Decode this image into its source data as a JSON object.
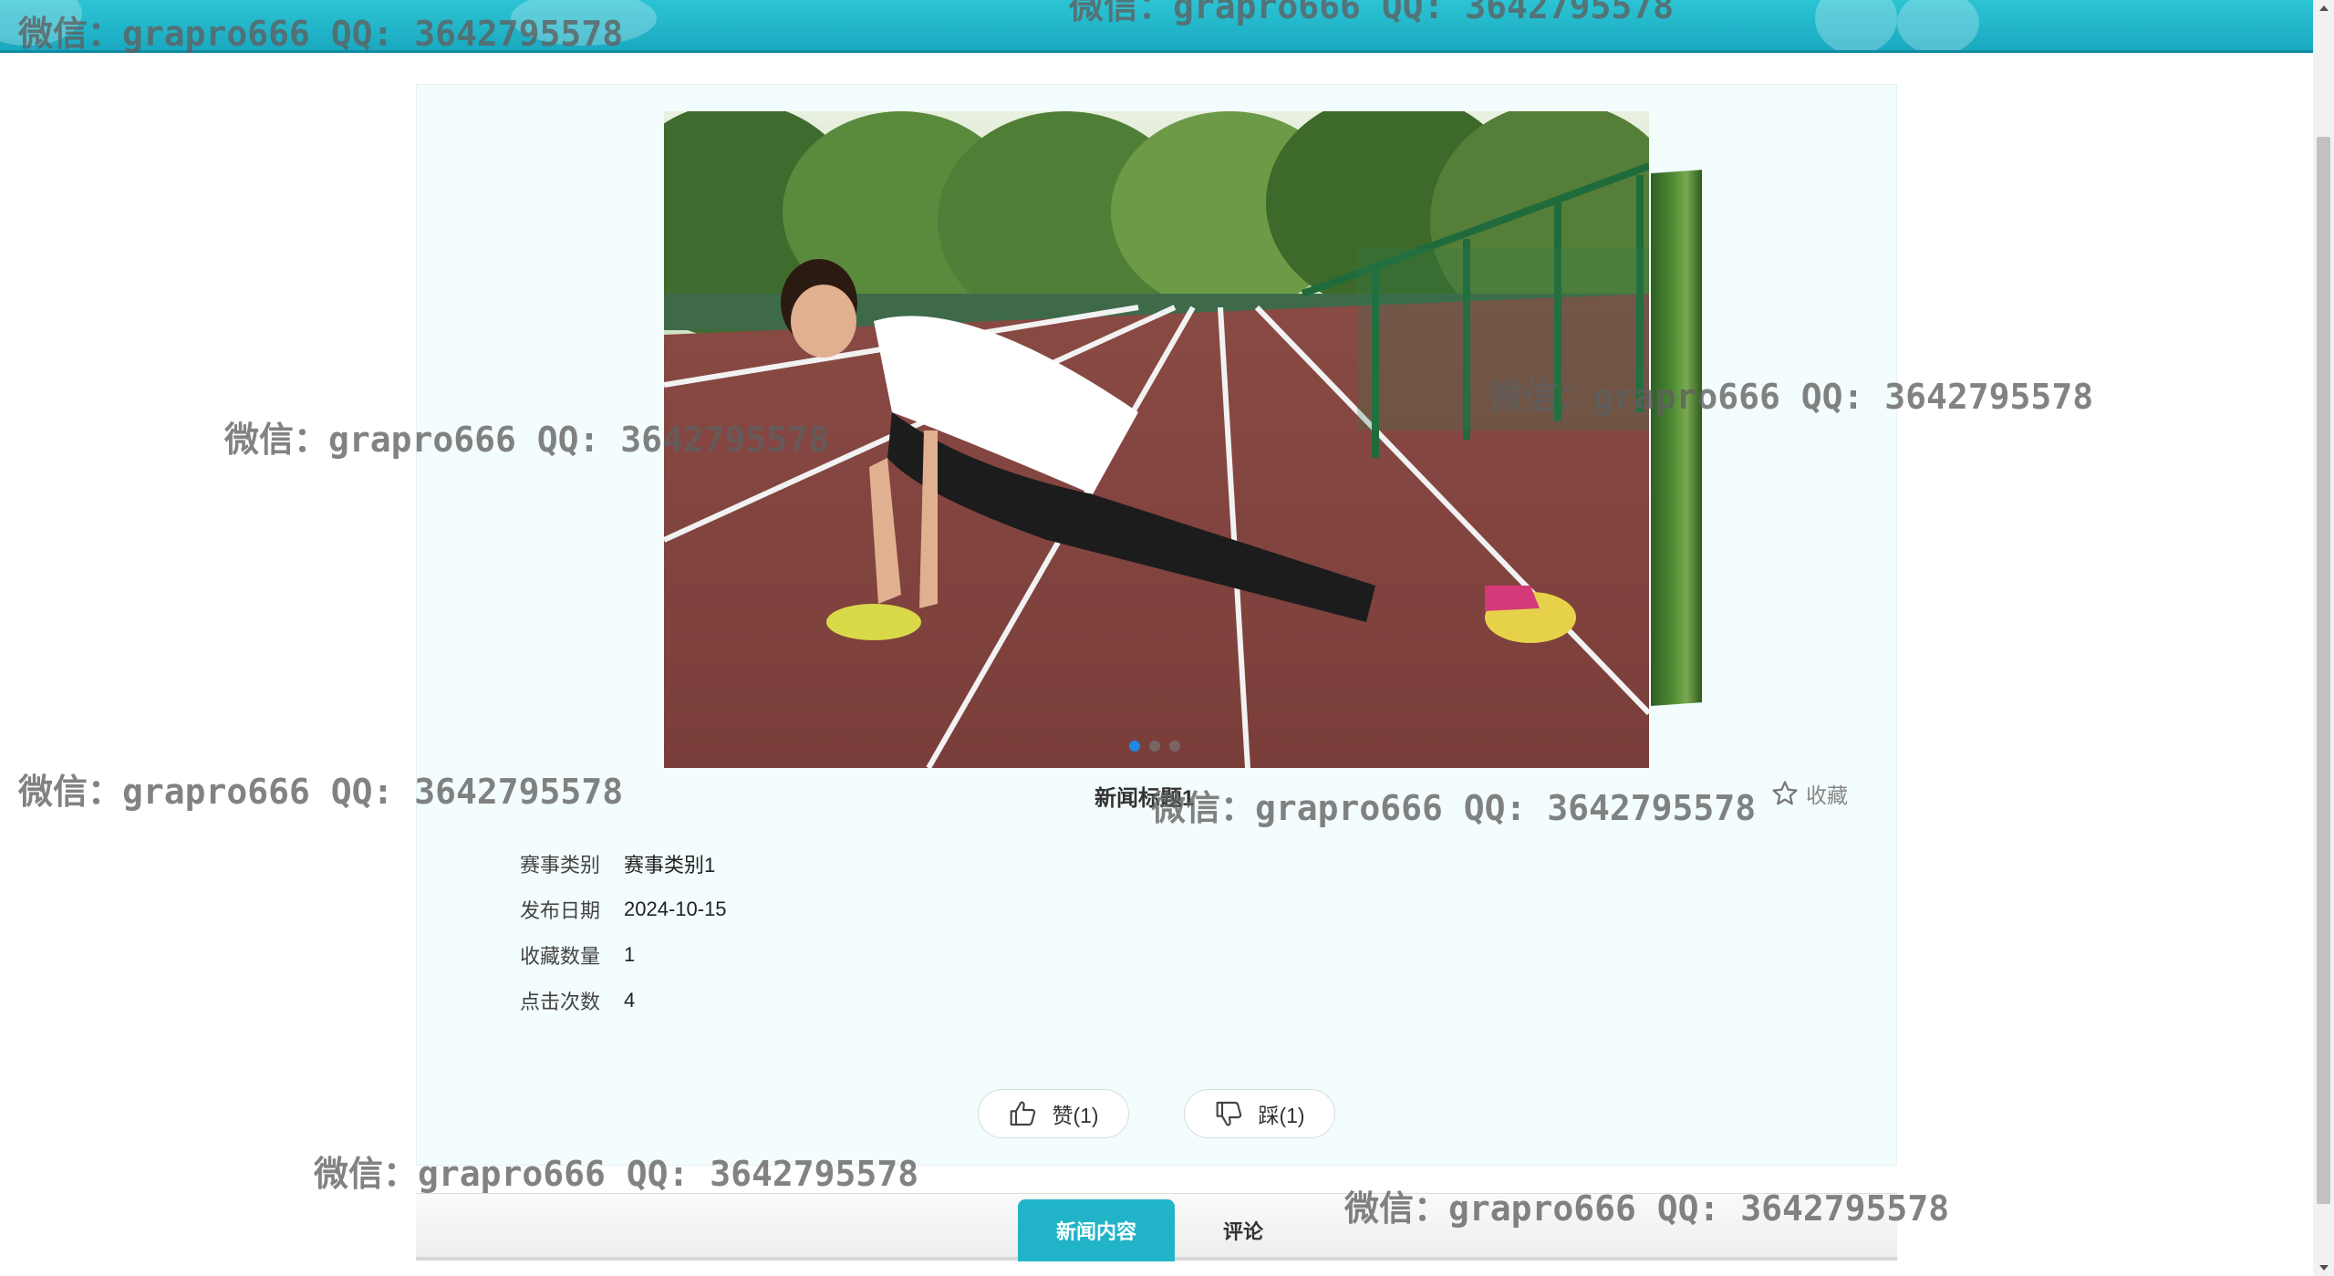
{
  "news": {
    "title": "新闻标题1",
    "favorite_label": "收藏",
    "fields": [
      {
        "label": "赛事类别",
        "value": "赛事类别1"
      },
      {
        "label": "发布日期",
        "value": "2024-10-15"
      },
      {
        "label": "收藏数量",
        "value": "1"
      },
      {
        "label": "点击次数",
        "value": "4"
      }
    ],
    "like_label": "赞(1)",
    "dislike_label": "踩(1)"
  },
  "carousel": {
    "slide_count": 3,
    "active_index": 0
  },
  "tabs": [
    {
      "label": "新闻内容",
      "active": true
    },
    {
      "label": "评论",
      "active": false
    }
  ],
  "watermarks": [
    "微信：grapro666 QQ: 3642795578",
    "微信：grapro666 QQ: 3642795578",
    "微信：grapro666 QQ: 3642795578",
    "微信：grapro666 QQ: 3642795578",
    "微信：grapro666 QQ: 3642795578",
    "微信：grapro666 QQ: 3642795578",
    "微信：grapro666 QQ: 3642795578",
    "微信：grapro666 QQ: 3642795578"
  ],
  "colors": {
    "header": "#1fb3c6",
    "panel_bg": "#f3fdfd",
    "active_tab": "#21b4c8",
    "active_dot": "#1e88e5"
  },
  "icons": {
    "favorite": "star-outline-icon",
    "like": "thumbs-up-icon",
    "dislike": "thumbs-down-icon"
  }
}
